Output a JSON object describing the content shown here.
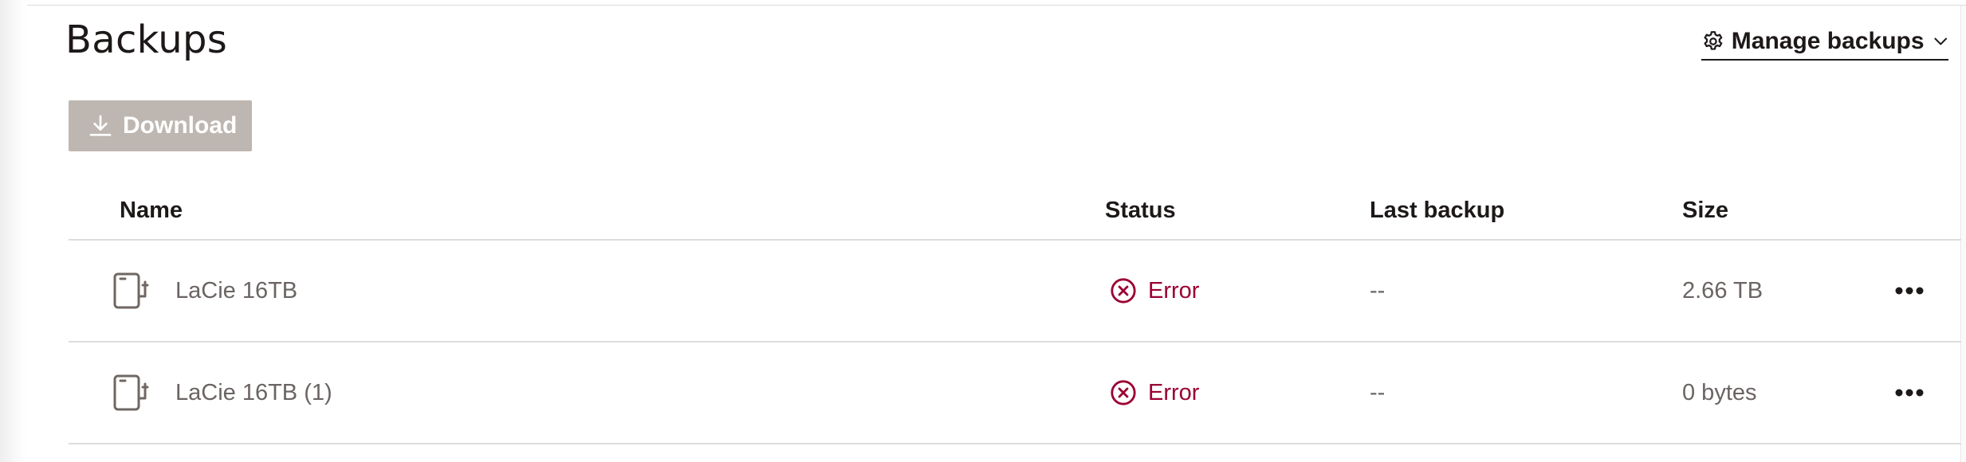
{
  "header": {
    "title": "Backups",
    "manage_label": "Manage backups"
  },
  "toolbar": {
    "download_label": "Download"
  },
  "table": {
    "columns": [
      "Name",
      "Status",
      "Last backup",
      "Size"
    ],
    "rows": [
      {
        "name": "LaCie 16TB",
        "status": "Error",
        "last_backup": "--",
        "size": "2.66 TB"
      },
      {
        "name": "LaCie 16TB (1)",
        "status": "Error",
        "last_backup": "--",
        "size": "0 bytes"
      }
    ]
  },
  "icons": {
    "manage": "gear-icon",
    "manage_menu": "chevron-down-icon",
    "download": "download-icon",
    "device": "external-drive-icon",
    "status": "error-circle-x-icon",
    "row_actions": "more-horizontal-icon"
  },
  "colors": {
    "text": "#1e1919",
    "muted_text": "#6a6462",
    "error": "#9b0032",
    "disabled_button": "#beb7b1",
    "divider": "#dcdcdc"
  }
}
